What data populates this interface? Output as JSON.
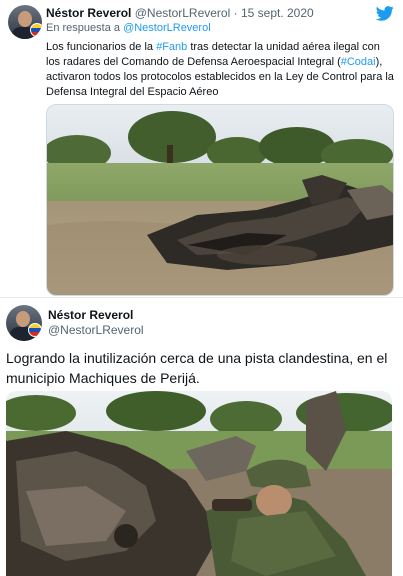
{
  "tweet1": {
    "author_name": "Néstor Reverol",
    "author_handle": "@NestorLReverol",
    "separator": "·",
    "date": "15 sept. 2020",
    "reply_prefix": "En respuesta a",
    "reply_handle": "@NestorLReverol",
    "text_part1": "Los funcionarios de la ",
    "hashtag1": "#Fanb",
    "text_part2": " tras detectar la unidad aérea ilegal con los radares del Comando de Defensa Aeroespacial Integral (",
    "hashtag2": "#Codai",
    "text_part3": "), activaron todos los protocolos establecidos en la Ley de Control para la Defensa Integral del Espacio Aéreo",
    "photo_alt": "Restos de aeronave quemada en un campo"
  },
  "tweet2": {
    "author_name": "Néstor Reverol",
    "author_handle": "@NestorLReverol",
    "text": "Logrando la inutilización cerca de una pista clandestina, en el municipio Machiques de Perijá.",
    "photo_alt": "Soldado inspeccionando restos de avioneta"
  },
  "colors": {
    "link": "#1d9bf0",
    "text": "#0f1419",
    "secondary": "#536471",
    "twitter_blue": "#1d9bf0"
  },
  "icons": {
    "brand": "twitter-bird-icon"
  }
}
